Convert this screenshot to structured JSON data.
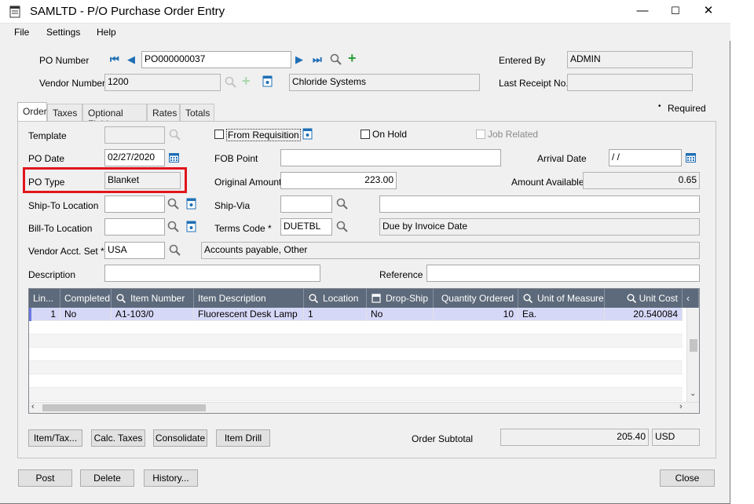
{
  "window": {
    "title": "SAMLTD - P/O Purchase Order Entry",
    "minimize": "—",
    "maximize": "☐",
    "close": "✕"
  },
  "menu": {
    "file": "File",
    "settings": "Settings",
    "help": "Help"
  },
  "header": {
    "po_number_label": "PO Number",
    "po_number": "PO000000037",
    "vendor_number_label": "Vendor Number",
    "vendor_number": "1200",
    "vendor_name": "Chloride Systems",
    "entered_by_label": "Entered By",
    "entered_by": "ADMIN",
    "last_receipt_label": "Last Receipt No.",
    "last_receipt": ""
  },
  "required_note": "Required",
  "tabs": [
    "Order",
    "Taxes",
    "Optional Fields",
    "Rates",
    "Totals"
  ],
  "order": {
    "template_label": "Template",
    "template": "",
    "from_requisition_label": "From Requisition",
    "on_hold_label": "On Hold",
    "job_related_label": "Job Related",
    "po_date_label": "PO Date",
    "po_date": "02/27/2020",
    "fob_point_label": "FOB Point",
    "fob_point": "",
    "arrival_date_label": "Arrival Date",
    "arrival_date": " / /",
    "po_type_label": "PO Type",
    "po_type": "Blanket",
    "original_amount_label": "Original Amount",
    "original_amount": "223.00",
    "amount_available_label": "Amount Available",
    "amount_available": "0.65",
    "ship_to_label": "Ship-To Location",
    "ship_to": "",
    "ship_via_label": "Ship-Via",
    "ship_via": "",
    "ship_via_desc": "",
    "bill_to_label": "Bill-To Location",
    "bill_to": "",
    "terms_code_label": "Terms Code *",
    "terms_code": "DUETBL",
    "terms_desc": "Due by Invoice Date",
    "vendor_acct_set_label": "Vendor Acct. Set *",
    "vendor_acct_set": "USA",
    "vendor_acct_set_desc": "Accounts payable, Other",
    "description_label": "Description",
    "description": "",
    "reference_label": "Reference",
    "reference": ""
  },
  "grid": {
    "columns": [
      "Lin...",
      "Completed",
      "Item Number",
      "Item Description",
      "Location",
      "Drop-Ship",
      "Quantity Ordered",
      "Unit of Measure",
      "Unit Cost"
    ],
    "rows": [
      [
        "1",
        "No",
        "A1-103/0",
        "Fluorescent Desk Lamp",
        "1",
        "No",
        "10",
        "Ea.",
        "20.540084"
      ]
    ]
  },
  "buttons": {
    "item_tax": "Item/Tax...",
    "calc_taxes": "Calc. Taxes",
    "consolidate": "Consolidate",
    "item_drill": "Item Drill",
    "post": "Post",
    "delete": "Delete",
    "history": "History...",
    "close": "Close"
  },
  "totals": {
    "order_subtotal_label": "Order Subtotal",
    "order_subtotal": "205.40",
    "currency": "USD"
  },
  "colors": {
    "highlight": "#e0151b",
    "grid_header": "#5d6a7b",
    "selected_row": "#d6d8f7"
  }
}
